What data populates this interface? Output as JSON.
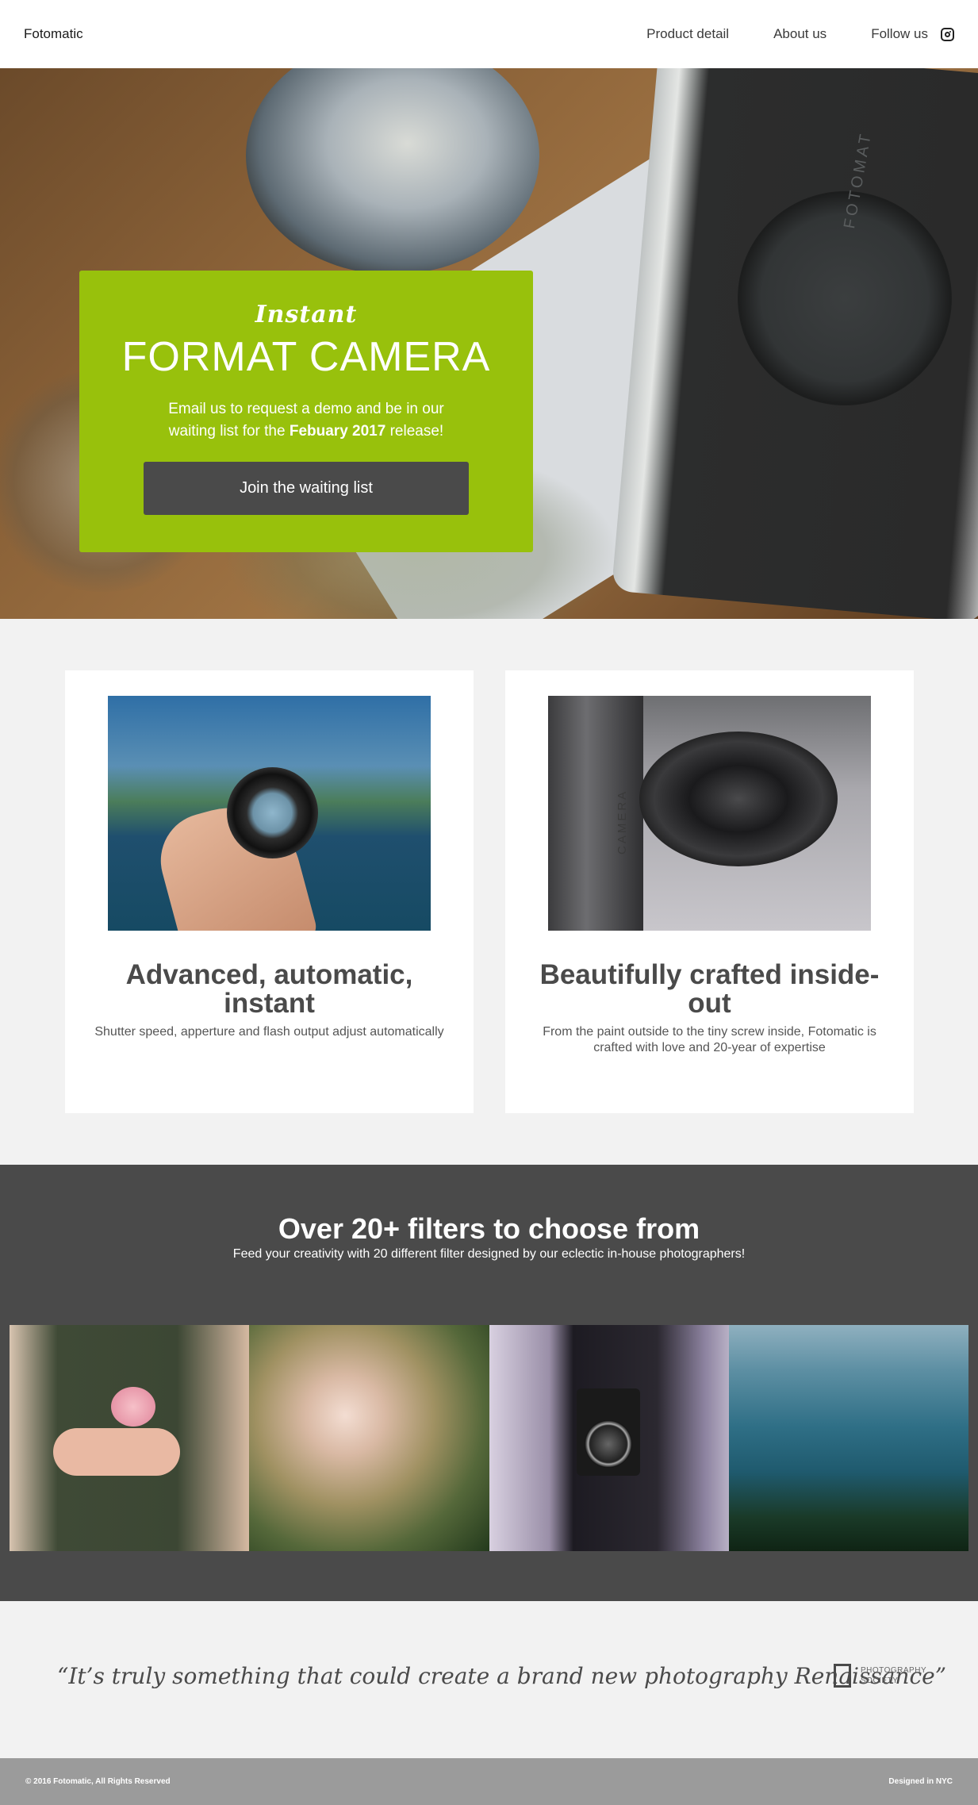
{
  "nav": {
    "brand": "Fotomatic",
    "links": [
      {
        "label": "Product detail"
      },
      {
        "label": "About us"
      },
      {
        "label": "Follow us"
      }
    ],
    "follow_icon": "instagram-icon"
  },
  "hero": {
    "script_title": "Instant",
    "title": "FORMAT CAMERA",
    "desc_pre": "Email us to request a demo and be in our waiting list for the ",
    "desc_bold": "Febuary 2017",
    "desc_post": " release!",
    "cta": "Join the waiting list",
    "camera_text": "FOTOMAT",
    "accent_color": "#98c10c"
  },
  "features": [
    {
      "title": "Advanced, automatic, instant",
      "text": "Shutter speed, apperture and flash output adjust automatically"
    },
    {
      "title": "Beautifully crafted inside-out",
      "text": "From the paint outside to the tiny screw inside, Fotomatic is crafted with love and 20-year of expertise"
    }
  ],
  "feature_photo_text": "CAMERA",
  "filters": {
    "title": "Over 20+ filters to choose from",
    "subtitle": "Feed your creativity with 20 different filter designed by our eclectic in-house photographers!"
  },
  "testimonial": {
    "quote": "“It’s truly something that could create a brand new photography Renaissance”",
    "org": "PHOTOGRAPHY SOCIETY"
  },
  "footer": {
    "copyright": "© 2016 Fotomatic, All Rights Reserved",
    "credit": "Designed in NYC"
  },
  "colors": {
    "dark": "#4a4a4a",
    "footer": "#9b9b9b",
    "bg": "#f2f2f2"
  }
}
